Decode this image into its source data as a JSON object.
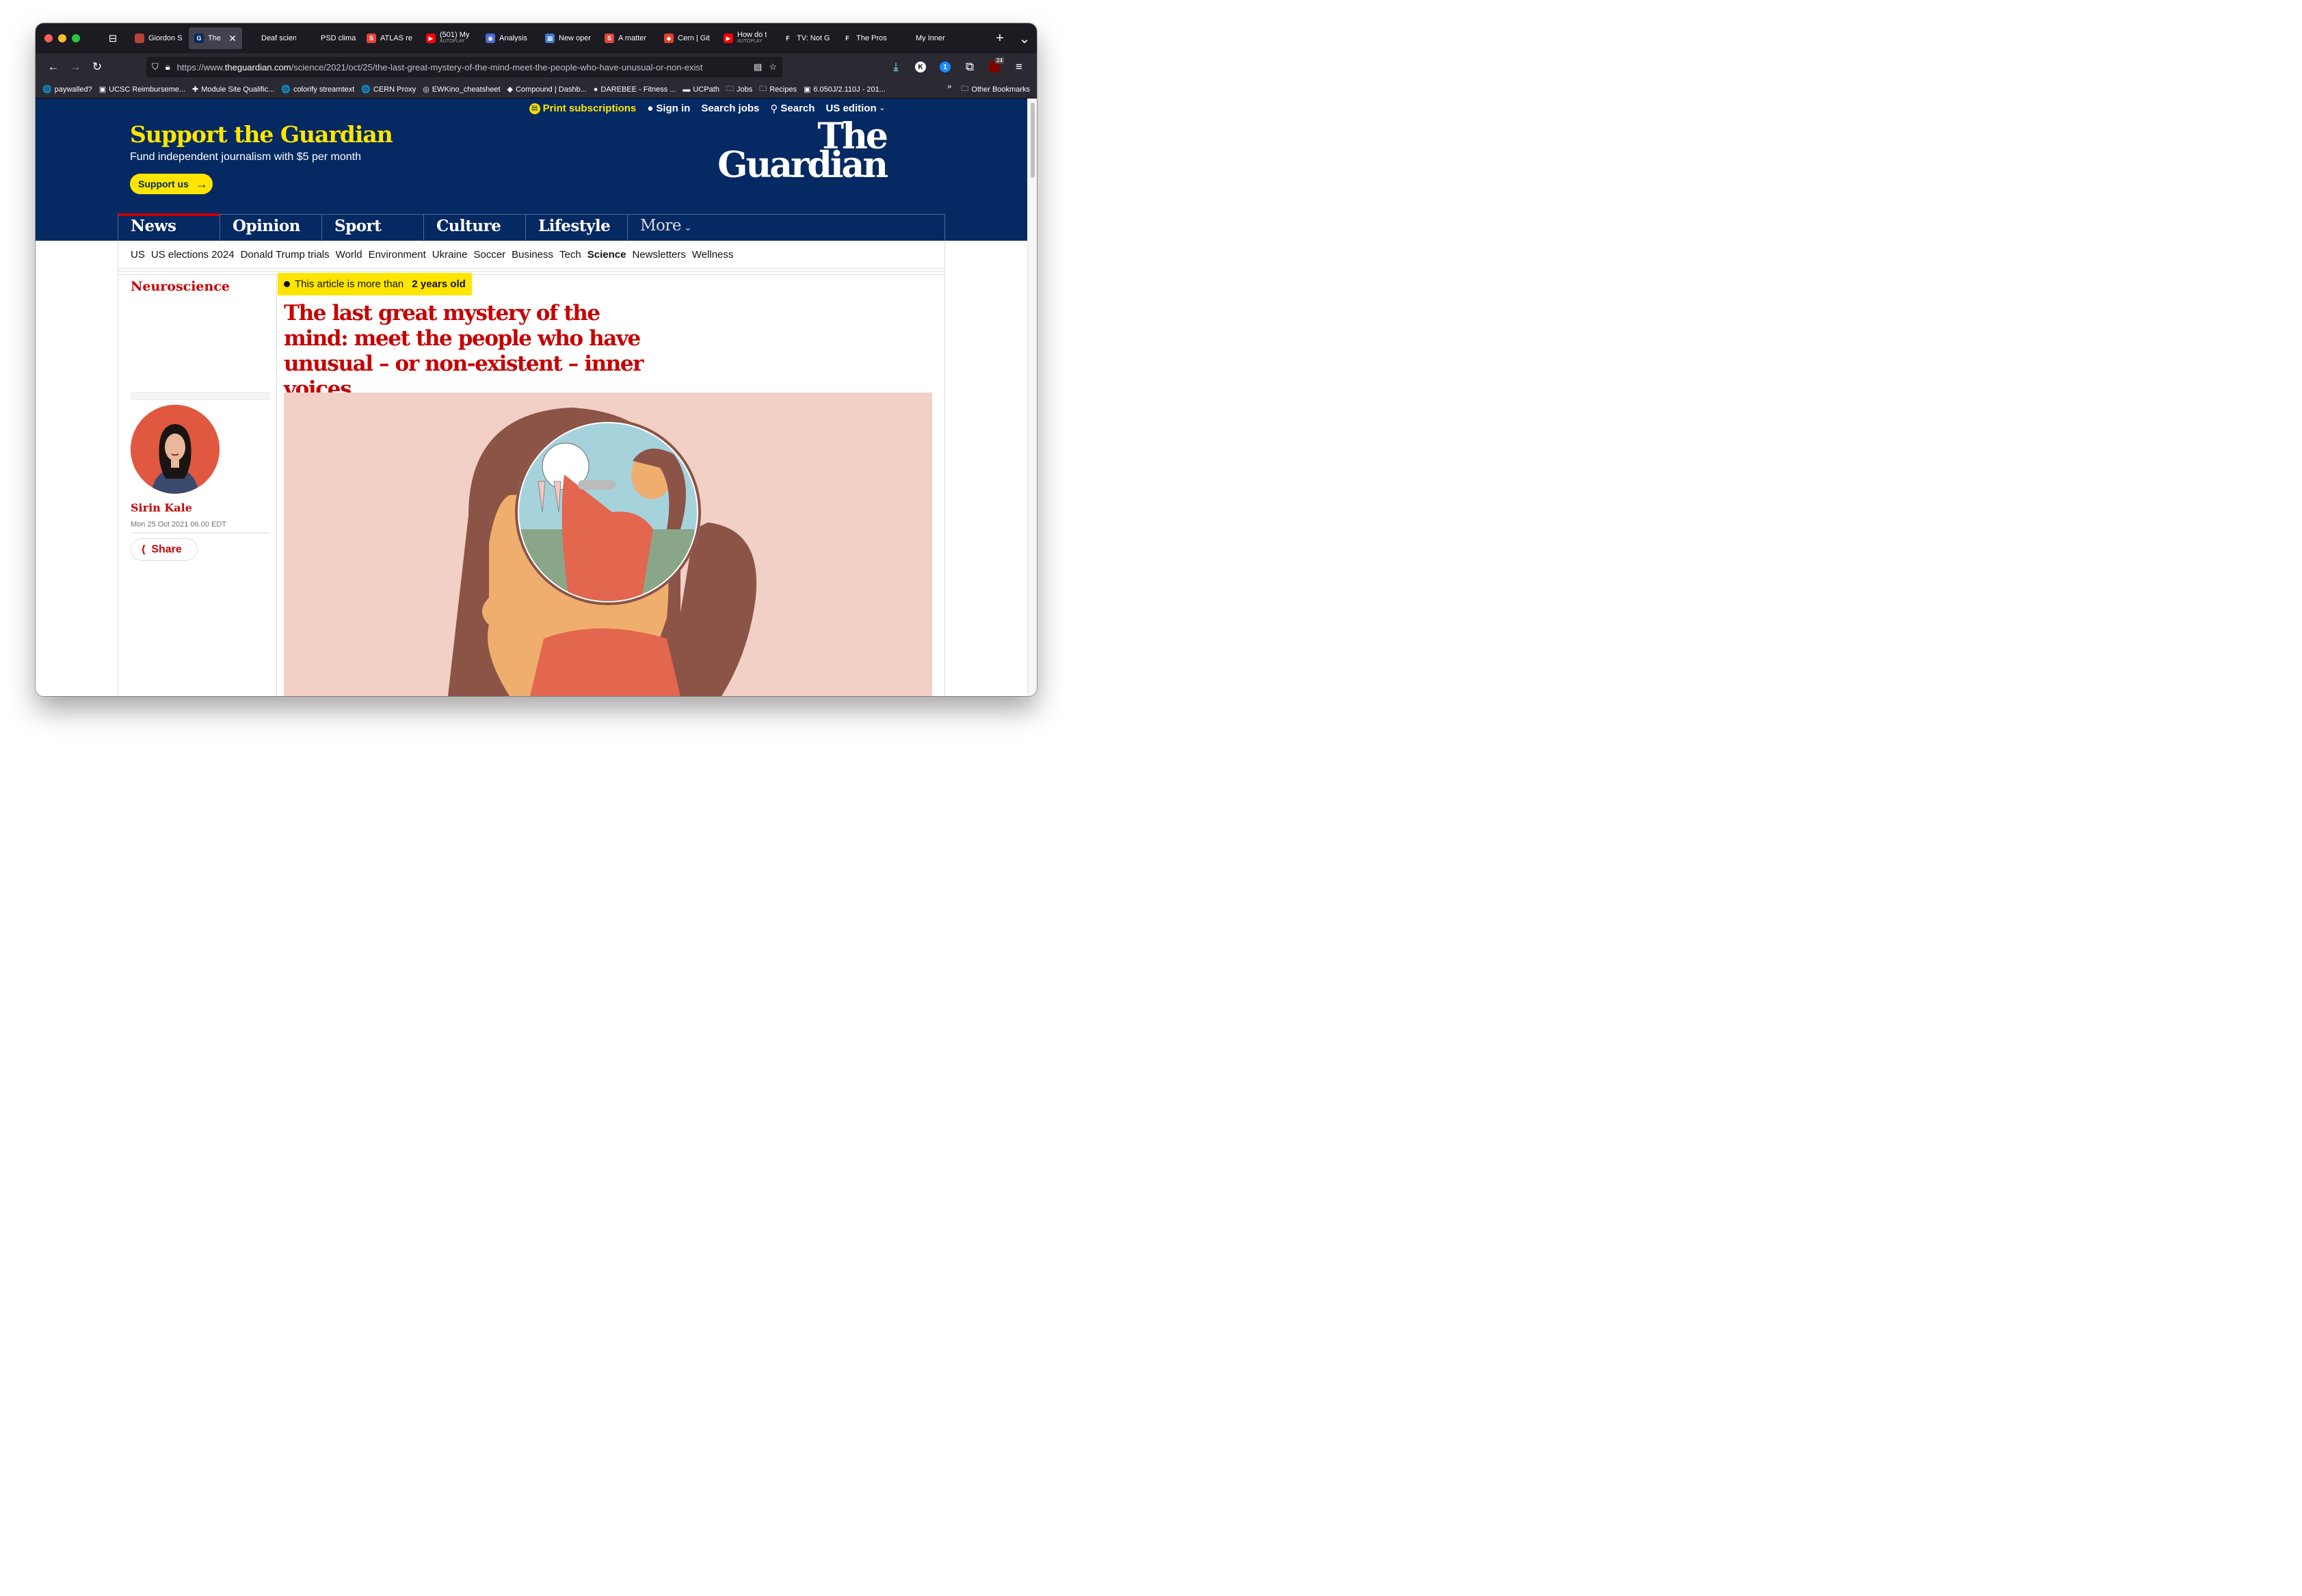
{
  "browser": {
    "tabs": [
      {
        "label": "Giordon S",
        "fav_color": "#b5413a",
        "fav_glyph": ""
      },
      {
        "label": "The la",
        "fav_color": "#052962",
        "fav_glyph": "G",
        "active": true
      },
      {
        "label": "Deaf scientist",
        "fav_color": "",
        "fav_glyph": ""
      },
      {
        "label": "PSD climate",
        "fav_color": "",
        "fav_glyph": ""
      },
      {
        "label": "ATLAS re",
        "fav_color": "#e5453b",
        "fav_glyph": "S"
      },
      {
        "label": "(501) My",
        "sub": "AUTOPLAY",
        "fav_color": "#ff0000",
        "fav_glyph": "▶"
      },
      {
        "label": "Analysis",
        "fav_color": "#4b6bd6",
        "fav_glyph": "◉"
      },
      {
        "label": "New oper",
        "fav_color": "#3a7bd5",
        "fav_glyph": "▦"
      },
      {
        "label": "A matter",
        "fav_color": "#e5453b",
        "fav_glyph": "S"
      },
      {
        "label": "Cern | Git",
        "fav_color": "#e2432a",
        "fav_glyph": "◆"
      },
      {
        "label": "How do t",
        "sub": "AUTOPLAY",
        "fav_color": "#ff0000",
        "fav_glyph": "▶"
      },
      {
        "label": "TV: Not G",
        "fav_color": "",
        "fav_glyph": "F"
      },
      {
        "label": "The Pros",
        "fav_color": "",
        "fav_glyph": "F"
      },
      {
        "label": "My Inner",
        "fav_color": "",
        "fav_glyph": ""
      }
    ],
    "url_prefix": "https://www.",
    "url_domain": "theguardian.com",
    "url_path": "/science/2021/oct/25/the-last-great-mystery-of-the-mind-meet-the-people-who-have-unusual-or-non-exist",
    "extension_badge": "24",
    "bookmarks": [
      {
        "label": "paywalled?",
        "icon": "🌐"
      },
      {
        "label": "UCSC Reimburseme...",
        "icon": "▣"
      },
      {
        "label": "Module Site Qualific...",
        "icon": "✚"
      },
      {
        "label": "colorify streamtext",
        "icon": "🌐"
      },
      {
        "label": "CERN Proxy",
        "icon": "🌐"
      },
      {
        "label": "EWKino_cheatsheet",
        "icon": "◎"
      },
      {
        "label": "Compound | Dashb...",
        "icon": "◆"
      },
      {
        "label": "DAREBEE - Fitness ...",
        "icon": "●"
      },
      {
        "label": "UCPath",
        "icon": "▬"
      },
      {
        "label": "Jobs",
        "icon": "🗀"
      },
      {
        "label": "Recipes",
        "icon": "🗀"
      },
      {
        "label": "6.050J/2.110J - 201...",
        "icon": "▣"
      }
    ],
    "other_bookmarks": "Other Bookmarks"
  },
  "site": {
    "topbar": {
      "print": "Print subscriptions",
      "signin": "Sign in",
      "jobs": "Search jobs",
      "search": "Search",
      "edition": "US edition"
    },
    "support": {
      "title": "Support the Guardian",
      "subtitle": "Fund independent journalism with $5 per month",
      "button": "Support us"
    },
    "logo": {
      "line1": "The",
      "line2": "Guardian"
    },
    "pillars": [
      "News",
      "Opinion",
      "Sport",
      "Culture",
      "Lifestyle",
      "More"
    ],
    "subnav": [
      "US",
      "US elections 2024",
      "Donald Trump trials",
      "World",
      "Environment",
      "Ukraine",
      "Soccer",
      "Business",
      "Tech",
      "Science",
      "Newsletters",
      "Wellness"
    ],
    "subnav_current": "Science"
  },
  "article": {
    "section": "Neuroscience",
    "age_prefix": "This article is more than",
    "age_bold": "2 years old",
    "headline": "The last great mystery of the mind: meet the people who have unusual – or non-existent – inner voices",
    "author": "Sirin Kale",
    "date": "Mon 25 Oct 2021 06.00 EDT",
    "share": "Share"
  }
}
